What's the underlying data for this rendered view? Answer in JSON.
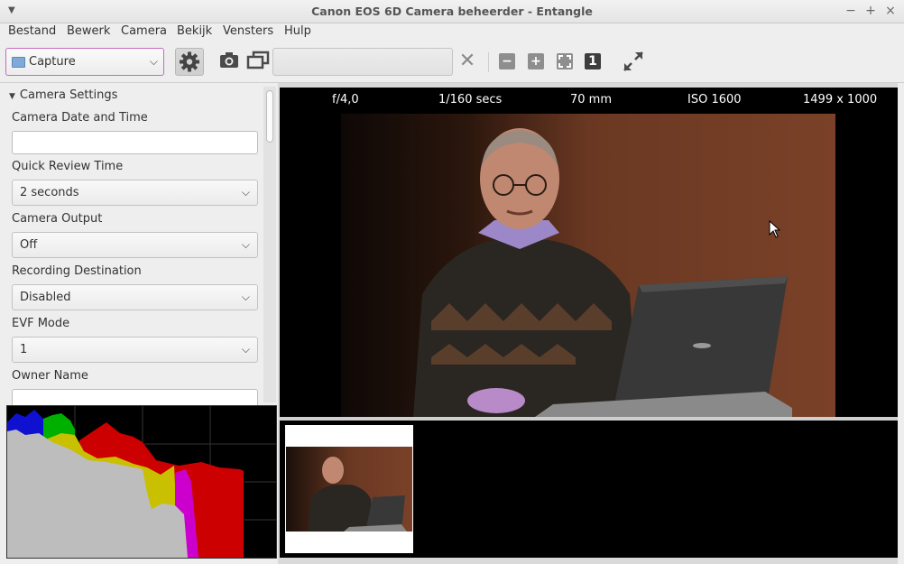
{
  "window": {
    "title": "Canon EOS 6D Camera beheerder - Entangle"
  },
  "menubar": {
    "items": [
      "Bestand",
      "Bewerk",
      "Camera",
      "Bekijk",
      "Vensters",
      "Hulp"
    ]
  },
  "toolbar": {
    "mode": "Capture",
    "icons": [
      "preferences-gear-icon",
      "capture-camera-icon",
      "preview-slideshow-icon",
      "cancel-x-icon",
      "zoom-out-icon",
      "zoom-in-icon",
      "zoom-fit-icon",
      "zoom-normal-icon",
      "fullscreen-icon"
    ],
    "zoom_normal_label": "1"
  },
  "sidebar": {
    "section_title": "Camera Settings",
    "fields": [
      {
        "label": "Camera Date and Time",
        "type": "text",
        "value": ""
      },
      {
        "label": "Quick Review Time",
        "type": "select",
        "value": "2 seconds"
      },
      {
        "label": "Camera Output",
        "type": "select",
        "value": "Off"
      },
      {
        "label": "Recording Destination",
        "type": "select",
        "value": "Disabled"
      },
      {
        "label": "EVF Mode",
        "type": "select",
        "value": "1"
      },
      {
        "label": "Owner Name",
        "type": "text",
        "value": ""
      }
    ]
  },
  "viewer": {
    "aperture": "f/4,0",
    "shutter": "1/160 secs",
    "focal_length": "70 mm",
    "iso": "ISO 1600",
    "dimensions": "1499 x 1000"
  },
  "colors": {
    "histogram_red": "#cc0000",
    "histogram_green": "#00aa00",
    "histogram_blue": "#0000cc",
    "histogram_yellow": "#c8c000",
    "histogram_magenta": "#cc00cc",
    "selection_border": "#c86ac0"
  }
}
